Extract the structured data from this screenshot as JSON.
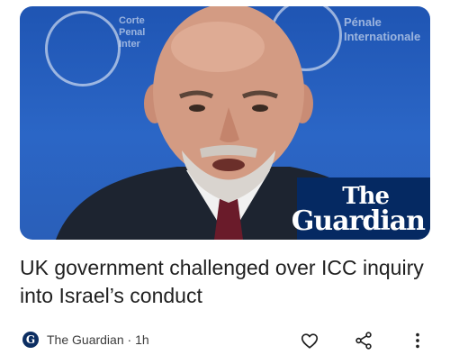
{
  "article": {
    "headline": "UK government challenged over ICC inquiry into Israel’s conduct",
    "source": "The Guardian",
    "separator": "·",
    "age": "1h"
  },
  "hero": {
    "brand_line1": "The",
    "brand_line2": "Guardian",
    "wall_text_left": [
      "Corte",
      "Penal",
      "Inter"
    ],
    "wall_text_right": [
      "Pénale",
      "Internationale"
    ]
  },
  "icons": {
    "source": "guardian-logo-icon",
    "like": "heart-outline-icon",
    "share": "share-icon",
    "more": "more-vert-icon"
  },
  "colors": {
    "brand_navy": "#052962",
    "backdrop_blue": "#2b66c6",
    "text": "#1f1f1f",
    "muted": "#3c3c3c"
  }
}
